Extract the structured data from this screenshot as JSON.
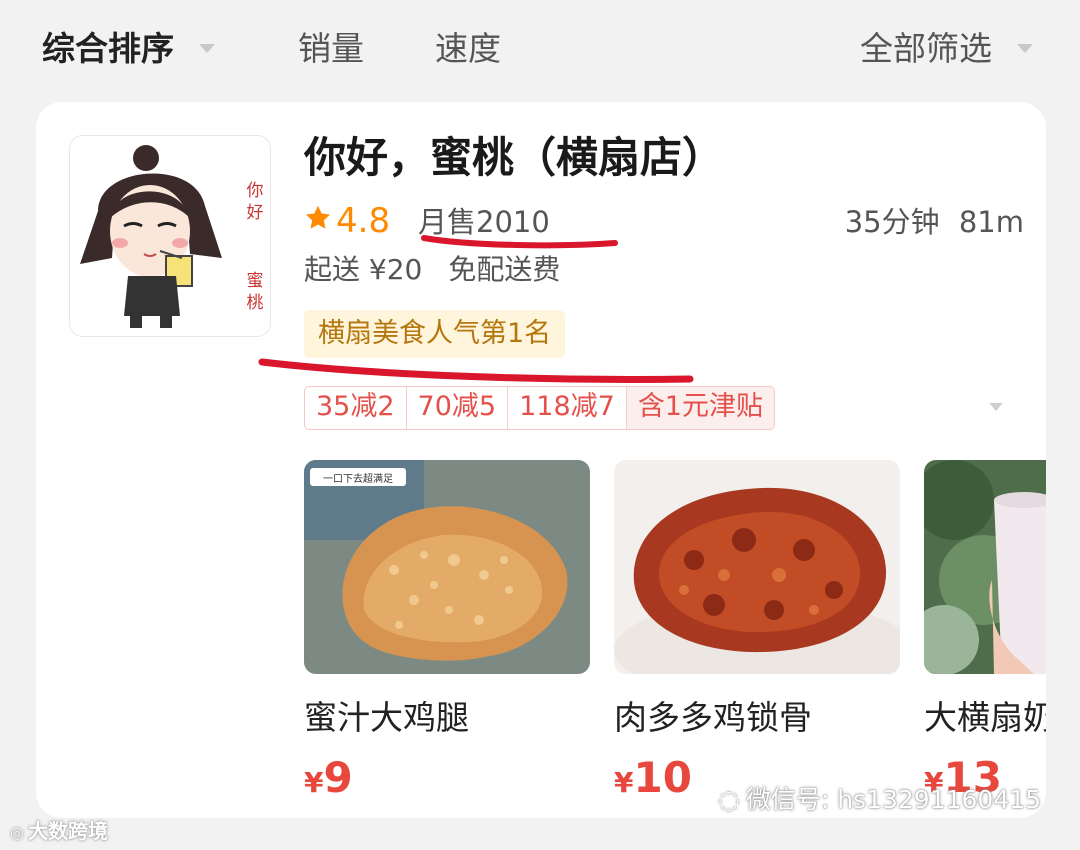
{
  "sort_bar": {
    "items": [
      "综合排序",
      "销量",
      "速度"
    ],
    "filter": "全部筛选"
  },
  "store": {
    "name": "你好，蜜桃（横扇店）",
    "logo_text": "你好蜜桃",
    "rating": "4.8",
    "monthly_sales": "月售2010",
    "delivery_time": "35分钟",
    "distance": "81m",
    "min_order": "起送 ¥20",
    "delivery_fee": "免配送费",
    "rank_badge": "横扇美食人气第1名",
    "promotions": [
      "35减2",
      "70减5",
      "118减7"
    ],
    "subsidy": "含1元津贴"
  },
  "dishes": [
    {
      "name": "蜜汁大鸡腿",
      "currency": "¥",
      "price": "9",
      "image_caption": "一口下去超满足"
    },
    {
      "name": "肉多多鸡锁骨",
      "currency": "¥",
      "price": "10"
    },
    {
      "name": "大横扇奶",
      "currency": "¥",
      "price": "13"
    }
  ],
  "watermarks": {
    "left": "大数跨境",
    "right": "微信号: hs13291160415"
  },
  "colors": {
    "accent_orange": "#ff8a00",
    "price_red": "#e8473d",
    "annotation_red": "#d9162b",
    "badge_bg": "#fff4dc"
  }
}
